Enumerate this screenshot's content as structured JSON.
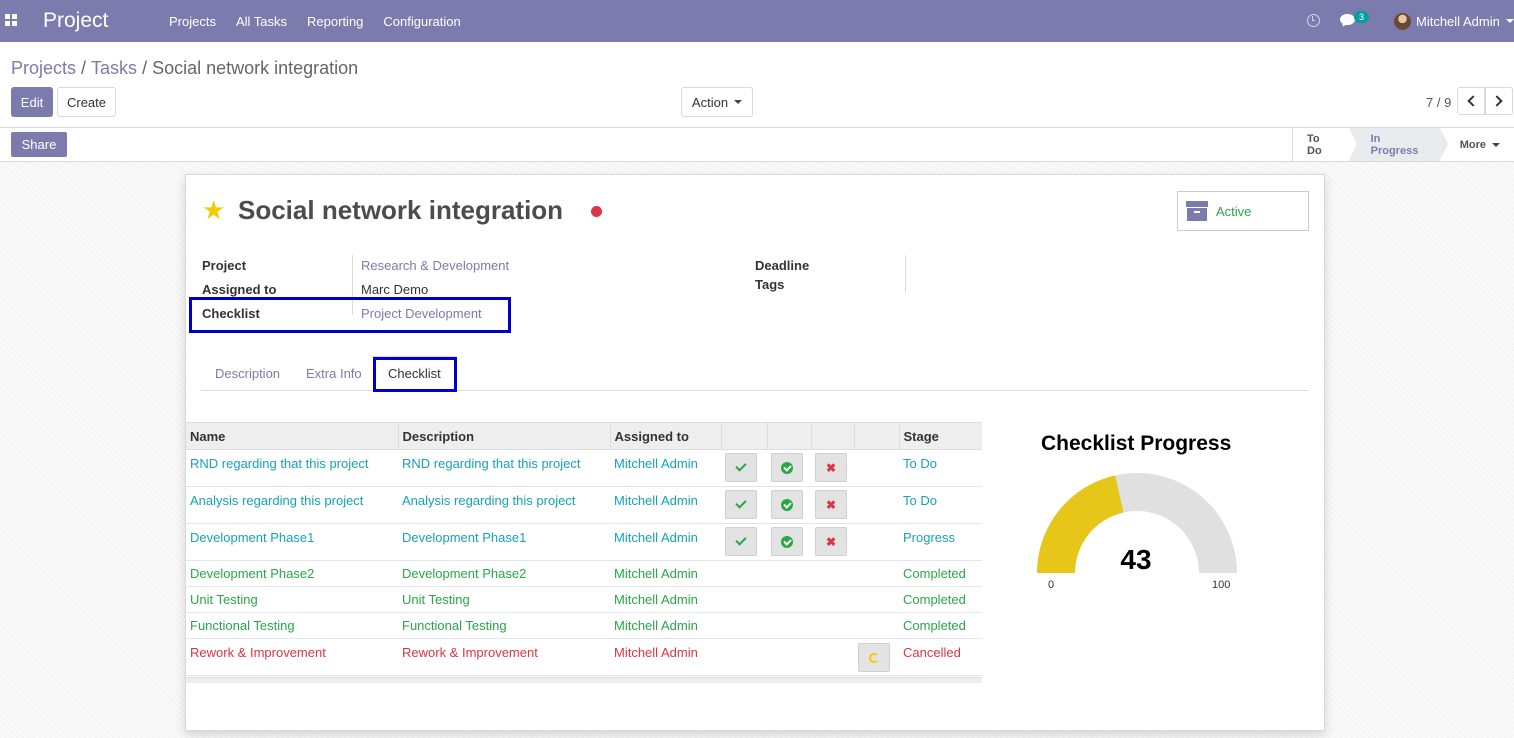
{
  "nav": {
    "app_title": "Project",
    "menu": [
      "Projects",
      "All Tasks",
      "Reporting",
      "Configuration"
    ],
    "message_count": "3",
    "user_name": "Mitchell Admin"
  },
  "breadcrumb": {
    "projects": "Projects",
    "tasks": "Tasks",
    "current": "Social network integration"
  },
  "buttons": {
    "edit": "Edit",
    "create": "Create",
    "action": "Action",
    "share": "Share"
  },
  "pager": {
    "text": "7 / 9"
  },
  "stages": [
    "To Do",
    "In Progress",
    "More"
  ],
  "task": {
    "title": "Social network integration",
    "status_label": "Active",
    "fields": {
      "project_label": "Project",
      "project_value": "Research & Development",
      "assigned_label": "Assigned to",
      "assigned_value": "Marc Demo",
      "checklist_label": "Checklist",
      "checklist_value": "Project Development",
      "deadline_label": "Deadline",
      "tags_label": "Tags"
    }
  },
  "tabs": [
    "Description",
    "Extra Info",
    "Checklist"
  ],
  "checklist": {
    "headers": [
      "Name",
      "Description",
      "Assigned to",
      "",
      "",
      "",
      "",
      "Stage"
    ],
    "rows": [
      {
        "name": "RND regarding that this project",
        "description": "RND regarding that this project",
        "assigned": "Mitchell Admin",
        "stage": "To Do"
      },
      {
        "name": "Analysis regarding this project",
        "description": "Analysis regarding this project",
        "assigned": "Mitchell Admin",
        "stage": "To Do"
      },
      {
        "name": "Development Phase1",
        "description": "Development Phase1",
        "assigned": "Mitchell Admin",
        "stage": "Progress"
      },
      {
        "name": "Development Phase2",
        "description": "Development Phase2",
        "assigned": "Mitchell Admin",
        "stage": "Completed"
      },
      {
        "name": "Unit Testing",
        "description": "Unit Testing",
        "assigned": "Mitchell Admin",
        "stage": "Completed"
      },
      {
        "name": "Functional Testing",
        "description": "Functional Testing",
        "assigned": "Mitchell Admin",
        "stage": "Completed"
      },
      {
        "name": "Rework & Improvement",
        "description": "Rework & Improvement",
        "assigned": "Mitchell Admin",
        "stage": "Cancelled"
      }
    ]
  },
  "gauge": {
    "title": "Checklist Progress",
    "value": 43,
    "min": "0",
    "max": "100",
    "fill_color": "#e6c619",
    "track_color": "#e0e0e0"
  },
  "colors": {
    "brand": "#7c7bad",
    "todo": "#17a2b8",
    "completed": "#28a745",
    "cancelled": "#dc3545",
    "highlight": "#0000cc"
  }
}
